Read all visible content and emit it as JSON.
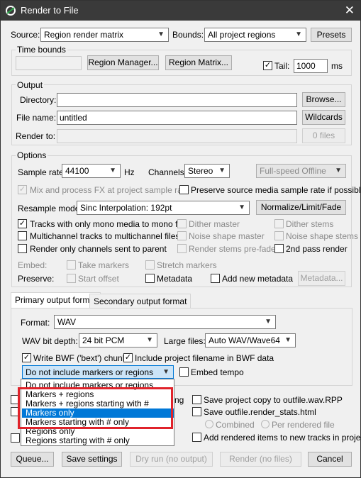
{
  "title": "Render to File",
  "source": {
    "label": "Source:",
    "value": "Region render matrix"
  },
  "bounds": {
    "label": "Bounds:",
    "value": "All project regions"
  },
  "presets_label": "Presets",
  "time_bounds": {
    "label": "Time bounds",
    "region_manager": "Region Manager...",
    "region_matrix": "Region Matrix...",
    "tail_label": "Tail:",
    "tail_value": "1000",
    "tail_unit": "ms"
  },
  "output": {
    "label": "Output",
    "directory_label": "Directory:",
    "browse": "Browse...",
    "filename_label": "File name:",
    "filename_value": "untitled",
    "wildcards": "Wildcards",
    "render_to_label": "Render to:",
    "files_count": "0 files"
  },
  "options": {
    "label": "Options",
    "sample_rate_label": "Sample rate:",
    "sample_rate": "44100",
    "hz": "Hz",
    "channels_label": "Channels:",
    "channels": "Stereo",
    "speed": "Full-speed Offline",
    "mix_fx": "Mix and process FX at project sample rate",
    "preserve_rate": "Preserve source media sample rate if possible",
    "resample_label": "Resample mode:",
    "resample": "Sinc Interpolation: 192pt",
    "normalize": "Normalize/Limit/Fade",
    "mono": "Tracks with only mono media to mono file",
    "dither_master": "Dither master",
    "dither_stems": "Dither stems",
    "multichannel": "Multichannel tracks to multichannel files",
    "noise_master": "Noise shape master",
    "noise_stems": "Noise shape stems",
    "render_only": "Render only channels sent to parent",
    "render_prefader": "Render stems pre-fader",
    "second_pass": "2nd pass render",
    "embed_label": "Embed:",
    "take_markers": "Take markers",
    "stretch_markers": "Stretch markers",
    "preserve_label": "Preserve:",
    "start_offset": "Start offset",
    "metadata": "Metadata",
    "add_metadata": "Add new metadata",
    "metadata_btn": "Metadata..."
  },
  "tabs": [
    "Primary output format",
    "Secondary output format"
  ],
  "format": {
    "label": "Format:",
    "value": "WAV",
    "bit_depth_label": "WAV bit depth:",
    "bit_depth": "24 bit PCM",
    "large_files_label": "Large files:",
    "large_files": "Auto WAV/Wave64",
    "bwf": "Write BWF ('bext') chunk",
    "include_filename": "Include project filename in BWF data",
    "markers_value": "Do not include markers or regions",
    "embed_tempo": "Embed tempo"
  },
  "dropdown_items": [
    "Do not include markers or regions",
    "Markers + regions",
    "Markers + regions starting with #",
    "Markers only",
    "Markers starting with # only",
    "Regions only",
    "Regions starting with # only"
  ],
  "dropdown_selected": 3,
  "highlight_color": "#e0232b",
  "selection_color": "#0078d7",
  "lower": {
    "copy_project": "Save project copy to outfile.wav.RPP",
    "save_stats": "Save outfile.render_stats.html",
    "combined": "Combined",
    "per_rendered": "Per rendered file",
    "add_rendered": "Add rendered items to new tracks in project",
    "partial_ng": "ng"
  },
  "bottom": {
    "queue": "Queue...",
    "save_settings": "Save settings",
    "dry_run": "Dry run (no output)",
    "render": "Render (no files)",
    "cancel": "Cancel"
  }
}
